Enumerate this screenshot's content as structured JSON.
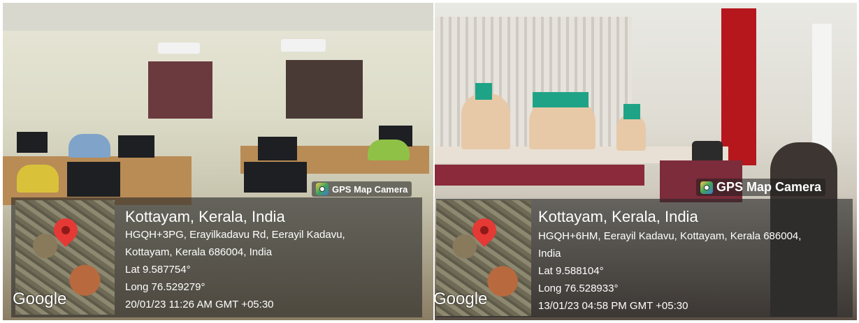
{
  "left_photo": {
    "badge": "GPS Map Camera",
    "place": "Kottayam, Kerala, India",
    "address_1": "HGQH+3PG, Erayilkadavu Rd, Eerayil Kadavu,",
    "address_2": "Kottayam, Kerala 686004, India",
    "lat": "Lat 9.587754°",
    "long": "Long 76.529279°",
    "timestamp": "20/01/23 11:26 AM GMT +05:30",
    "map_logo": "Google"
  },
  "right_photo": {
    "badge": "GPS Map Camera",
    "place": "Kottayam, Kerala, India",
    "address_1": "HGQH+6HM, Eerayil Kadavu, Kottayam, Kerala 686004,",
    "address_2": "India",
    "lat": "Lat 9.588104°",
    "long": "Long 76.528933°",
    "timestamp": "13/01/23 04:58 PM GMT +05:30",
    "map_logo": "Google"
  }
}
